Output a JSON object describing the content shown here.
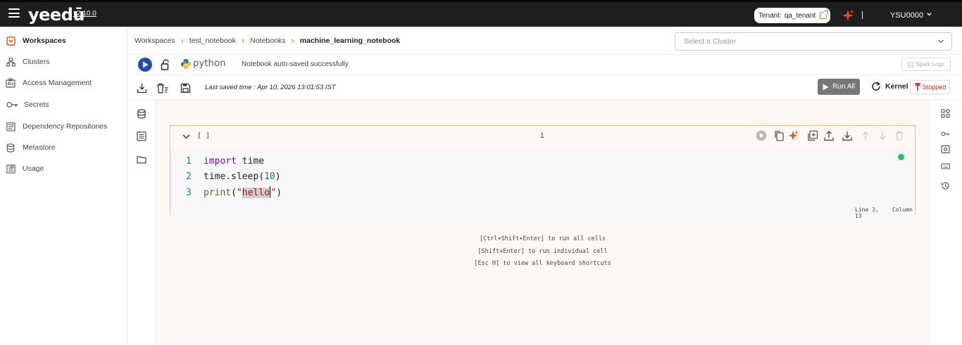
{
  "app": {
    "logo_text": "yeedū",
    "version": "v2.10.0"
  },
  "header": {
    "tenant_label": "Tenant:",
    "tenant_value": "qa_tenant",
    "user": "YSU0000",
    "accent_color": "#e8743b"
  },
  "sidebar": {
    "items": [
      {
        "label": "Workspaces",
        "icon": "workspace-icon",
        "active": true
      },
      {
        "label": "Clusters",
        "icon": "clusters-icon"
      },
      {
        "label": "Access Management",
        "icon": "access-management-icon"
      },
      {
        "label": "Secrets",
        "icon": "key-icon"
      },
      {
        "label": "Dependency Repositories",
        "icon": "repository-icon"
      },
      {
        "label": "Metastore",
        "icon": "database-icon"
      },
      {
        "label": "Usage",
        "icon": "usage-icon"
      }
    ]
  },
  "breadcrumb": {
    "items": [
      "Workspaces",
      "test_notebook",
      "Notebooks",
      "machine_learning_notebook"
    ]
  },
  "cluster_select": {
    "placeholder": "Select a Cluster"
  },
  "toolbar": {
    "language": "python",
    "autosave_status": "Notebook auto-saved successfully",
    "spark_logs_label": "Spark Logs",
    "last_saved": "Last saved time : Apr 10, 2026 13:01:53 IST",
    "run_all_label": "Run All",
    "kernel_label": "Kernel",
    "kernel_status": "Stopped"
  },
  "cell": {
    "execution_count": "[ ]",
    "cell_number": "1",
    "line_numbers": [
      "1",
      "2",
      "3"
    ],
    "code": {
      "line1_kw": "import",
      "line1_rest": " time",
      "line2_fn": "time.sleep",
      "line2_open": "(",
      "line2_num": "10",
      "line2_close": ")",
      "line3_fn": "print",
      "line3_open": "(",
      "line3_q1": "\"",
      "line3_sel": "hello",
      "line3_q2": "\"",
      "line3_close": ")"
    },
    "line_status": "Line 3,",
    "column_status": "Column 13",
    "status_color": "#22c55e"
  },
  "hints": [
    "[Ctrl+Shift+Enter] to run all cells",
    "[Shift+Enter] to run individual cell",
    "[Esc H] to view all keyboard shortcuts"
  ]
}
